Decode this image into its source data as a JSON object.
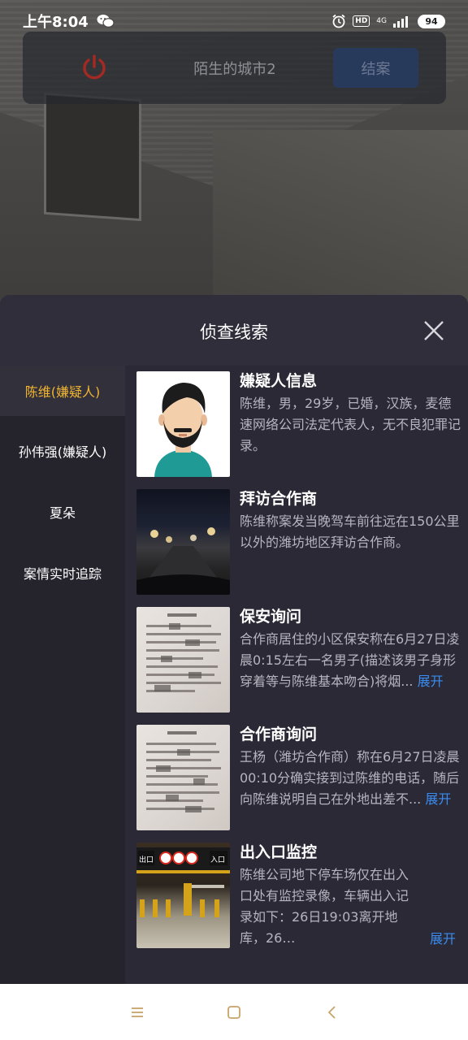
{
  "status_bar": {
    "time": "上午8:04",
    "hd": "HD",
    "network": "4G",
    "battery": "94",
    "icons": [
      "wechat-icon",
      "alarm-icon",
      "hd-icon",
      "signal-icon",
      "battery-icon"
    ]
  },
  "top_bar": {
    "title": "陌生的城市2",
    "close_case_label": "结案",
    "power_icon_color": "#a22a24"
  },
  "sheet": {
    "title": "侦查线索",
    "sidebar": [
      {
        "label": "陈维(嫌疑人)",
        "active": true
      },
      {
        "label": "孙伟强(嫌疑人)",
        "active": false
      },
      {
        "label": "夏朵",
        "active": false
      },
      {
        "label": "案情实时追踪",
        "active": false
      }
    ],
    "clues": [
      {
        "title": "嫌疑人信息",
        "desc": "陈维，男，29岁，已婚，汉族，麦德速网络公司法定代表人，无不良犯罪记录。",
        "expand": ""
      },
      {
        "title": "拜访合作商",
        "desc": "陈维称案发当晚驾车前往远在150公里以外的潍坊地区拜访合作商。",
        "expand": ""
      },
      {
        "title": "保安询问",
        "desc": "合作商居住的小区保安称在6月27日凌晨0:15左右一名男子(描述该男子身形穿着等与陈维基本吻合)将烟...",
        "expand": "展开"
      },
      {
        "title": "合作商询问",
        "desc": "王杨（潍坊合作商）称在6月27日凌晨00:10分确实接到过陈维的电话，随后向陈维说明自己在外地出差不...",
        "expand": "展开"
      },
      {
        "title": "出入口监控",
        "desc": "陈维公司地下停车场仅在出入口处有监控录像，车辆出入记录如下：26日19:03离开地库，26…",
        "expand": "展开"
      }
    ],
    "thumb_labels": {
      "exit_sign": "出口",
      "entry_sign": "入口"
    }
  },
  "colors": {
    "accent_active": "#f2b431",
    "link": "#3a8cf0",
    "sheet_bg": "#2b2935"
  },
  "nav": {
    "icons": [
      "menu-icon",
      "home-square-icon",
      "back-chevron-icon"
    ]
  }
}
